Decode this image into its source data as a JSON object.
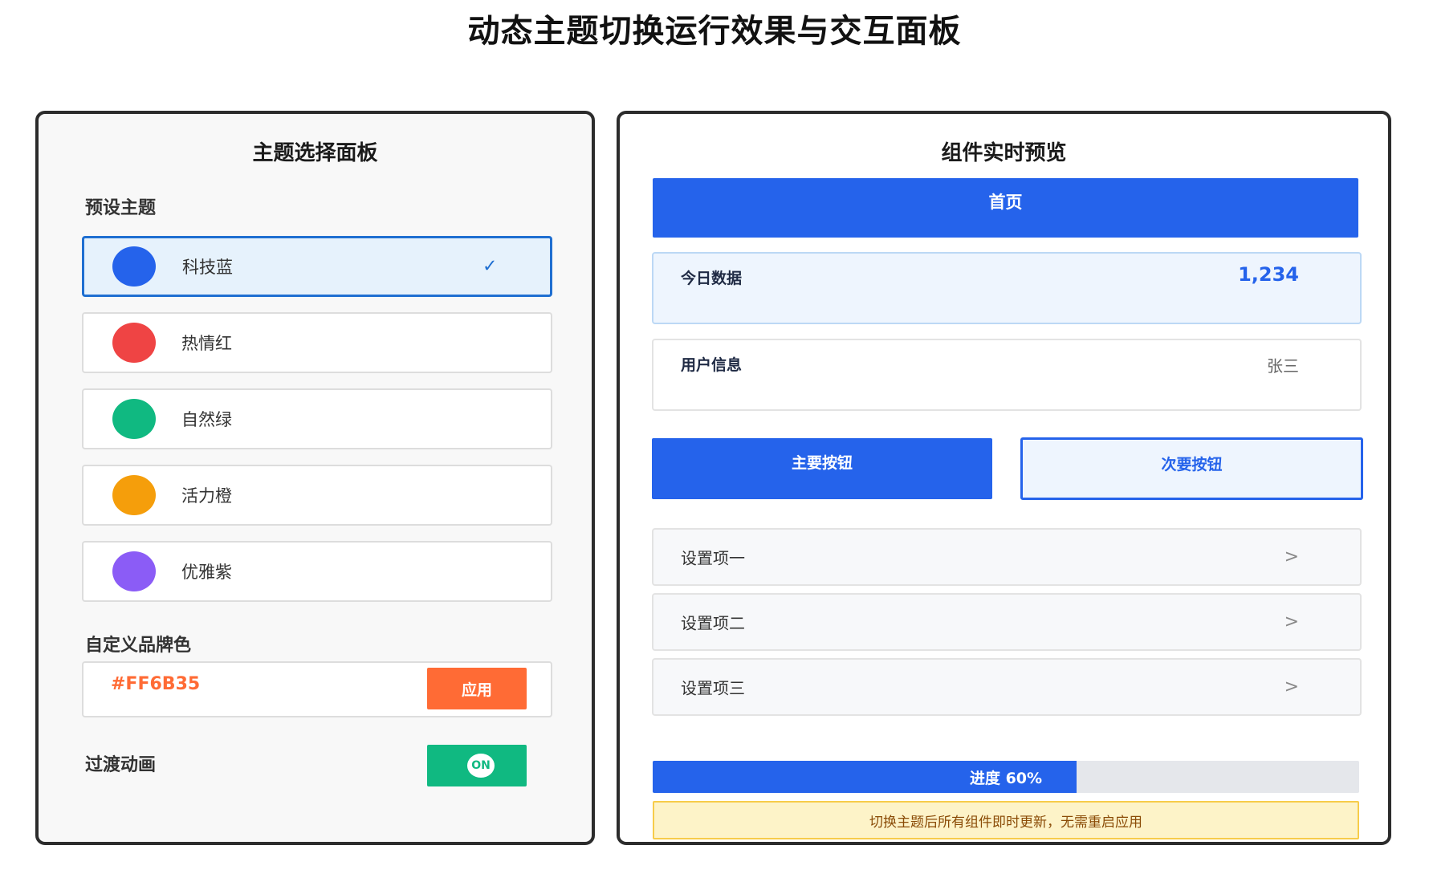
{
  "page": {
    "title": "动态主题切换运行效果与交互面板"
  },
  "left_panel": {
    "title": "主题选择面板",
    "preset_label": "预设主题",
    "themes": [
      {
        "name": "科技蓝",
        "color": "#2563eb",
        "selected": true,
        "check": "✓"
      },
      {
        "name": "热情红",
        "color": "#ef4444",
        "selected": false
      },
      {
        "name": "自然绿",
        "color": "#10b981",
        "selected": false
      },
      {
        "name": "活力橙",
        "color": "#f59e0b",
        "selected": false
      },
      {
        "name": "优雅紫",
        "color": "#8b5cf6",
        "selected": false
      }
    ],
    "custom_label": "自定义品牌色",
    "custom_hex": "#FF6B35",
    "apply_label": "应用",
    "transition_label": "过渡动画",
    "toggle_label": "ON",
    "toggle_on": true
  },
  "right_panel": {
    "title": "组件实时预览",
    "nav_label": "首页",
    "stat_card": {
      "label": "今日数据",
      "value": "1,234"
    },
    "user_card": {
      "label": "用户信息",
      "value": "张三"
    },
    "primary_button": "主要按钮",
    "secondary_button": "次要按钮",
    "settings": [
      {
        "label": "设置项一",
        "arrow": ">"
      },
      {
        "label": "设置项二",
        "arrow": ">"
      },
      {
        "label": "设置项三",
        "arrow": ">"
      }
    ],
    "progress": {
      "label": "进度 60%",
      "value": 0.6
    },
    "notice": "切换主题后所有组件即时更新，无需重启应用"
  },
  "colors": {
    "primary": "#2563eb",
    "custom": "#ff6b35",
    "toggle": "#10b981"
  }
}
